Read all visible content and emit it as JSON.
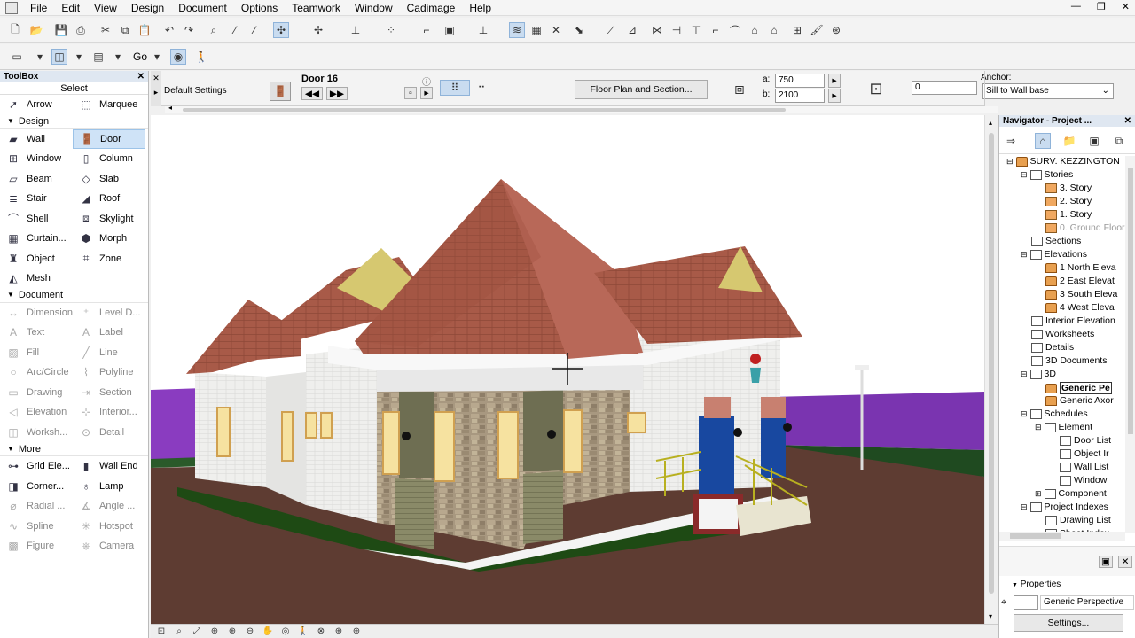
{
  "menu": [
    "File",
    "Edit",
    "View",
    "Design",
    "Document",
    "Options",
    "Teamwork",
    "Window",
    "Cadimage",
    "Help"
  ],
  "window_controls": {
    "minimize": "—",
    "restore": "❐",
    "close": "✕"
  },
  "toolbar2": {
    "go_label": "Go"
  },
  "toolbox": {
    "title": "ToolBox",
    "select_label": "Select",
    "select_tools": [
      {
        "label": "Arrow",
        "icon": "arrow-icon"
      },
      {
        "label": "Marquee",
        "icon": "marquee-icon"
      }
    ],
    "sections": [
      {
        "label": "Design",
        "tools": [
          {
            "label": "Wall",
            "icon": "wall-icon"
          },
          {
            "label": "Door",
            "icon": "door-icon",
            "selected": true
          },
          {
            "label": "Window",
            "icon": "window-icon"
          },
          {
            "label": "Column",
            "icon": "column-icon"
          },
          {
            "label": "Beam",
            "icon": "beam-icon"
          },
          {
            "label": "Slab",
            "icon": "slab-icon"
          },
          {
            "label": "Stair",
            "icon": "stair-icon"
          },
          {
            "label": "Roof",
            "icon": "roof-icon"
          },
          {
            "label": "Shell",
            "icon": "shell-icon"
          },
          {
            "label": "Skylight",
            "icon": "skylight-icon"
          },
          {
            "label": "Curtain...",
            "icon": "curtain-wall-icon"
          },
          {
            "label": "Morph",
            "icon": "morph-icon"
          },
          {
            "label": "Object",
            "icon": "object-icon"
          },
          {
            "label": "Zone",
            "icon": "zone-icon"
          },
          {
            "label": "Mesh",
            "icon": "mesh-icon"
          }
        ]
      },
      {
        "label": "Document",
        "tools": [
          {
            "label": "Dimension",
            "icon": "dimension-icon"
          },
          {
            "label": "Level D...",
            "icon": "level-dimension-icon"
          },
          {
            "label": "Text",
            "icon": "text-icon"
          },
          {
            "label": "Label",
            "icon": "label-icon"
          },
          {
            "label": "Fill",
            "icon": "fill-icon"
          },
          {
            "label": "Line",
            "icon": "line-icon"
          },
          {
            "label": "Arc/Circle",
            "icon": "arc-icon"
          },
          {
            "label": "Polyline",
            "icon": "polyline-icon"
          },
          {
            "label": "Drawing",
            "icon": "drawing-icon"
          },
          {
            "label": "Section",
            "icon": "section-icon"
          },
          {
            "label": "Elevation",
            "icon": "elevation-icon"
          },
          {
            "label": "Interior...",
            "icon": "interior-elevation-icon"
          },
          {
            "label": "Worksh...",
            "icon": "worksheet-icon"
          },
          {
            "label": "Detail",
            "icon": "detail-icon"
          }
        ]
      },
      {
        "label": "More",
        "tools": [
          {
            "label": "Grid Ele...",
            "icon": "grid-element-icon"
          },
          {
            "label": "Wall End",
            "icon": "wall-end-icon"
          },
          {
            "label": "Corner...",
            "icon": "corner-window-icon"
          },
          {
            "label": "Lamp",
            "icon": "lamp-icon"
          },
          {
            "label": "Radial ...",
            "icon": "radial-dimension-icon"
          },
          {
            "label": "Angle ...",
            "icon": "angle-dimension-icon"
          },
          {
            "label": "Spline",
            "icon": "spline-icon"
          },
          {
            "label": "Hotspot",
            "icon": "hotspot-icon"
          },
          {
            "label": "Figure",
            "icon": "figure-icon"
          },
          {
            "label": "Camera",
            "icon": "camera-icon"
          }
        ]
      }
    ]
  },
  "infobox": {
    "settings_label": "Default Settings",
    "element_name": "Door 16",
    "floor_plan_button": "Floor Plan and Section...",
    "a_label": "a:",
    "a_value": "750",
    "b_label": "b:",
    "b_value": "2100",
    "offset_value": "0",
    "anchor_label": "Anchor:",
    "anchor_value": "Sill to Wall base"
  },
  "navigator": {
    "title": "Navigator - Project ...",
    "tree": [
      {
        "label": "SURV. KEZZINGTON",
        "level": 0,
        "type": "house",
        "expander": "⊟"
      },
      {
        "label": "Stories",
        "level": 1,
        "type": "doc",
        "expander": "⊟"
      },
      {
        "label": "3. Story",
        "level": 2,
        "type": "folder"
      },
      {
        "label": "2. Story",
        "level": 2,
        "type": "folder"
      },
      {
        "label": "1. Story",
        "level": 2,
        "type": "folder"
      },
      {
        "label": "0. Ground Floor",
        "level": 2,
        "type": "folder",
        "dim": true
      },
      {
        "label": "Sections",
        "level": 1,
        "type": "doc"
      },
      {
        "label": "Elevations",
        "level": 1,
        "type": "doc",
        "expander": "⊟"
      },
      {
        "label": "1 North Eleva",
        "level": 2,
        "type": "house"
      },
      {
        "label": "2 East Elevat",
        "level": 2,
        "type": "house"
      },
      {
        "label": "3 South Eleva",
        "level": 2,
        "type": "house"
      },
      {
        "label": "4 West Eleva",
        "level": 2,
        "type": "house"
      },
      {
        "label": "Interior Elevation",
        "level": 1,
        "type": "doc"
      },
      {
        "label": "Worksheets",
        "level": 1,
        "type": "doc"
      },
      {
        "label": "Details",
        "level": 1,
        "type": "doc"
      },
      {
        "label": "3D Documents",
        "level": 1,
        "type": "doc"
      },
      {
        "label": "3D",
        "level": 1,
        "type": "doc",
        "expander": "⊟"
      },
      {
        "label": "Generic Pe",
        "level": 2,
        "type": "house",
        "selected": true
      },
      {
        "label": "Generic Axor",
        "level": 2,
        "type": "house"
      },
      {
        "label": "Schedules",
        "level": 1,
        "type": "doc",
        "expander": "⊟"
      },
      {
        "label": "Element",
        "level": 2,
        "type": "doc",
        "expander": "⊟"
      },
      {
        "label": "Door List",
        "level": 3,
        "type": "doc"
      },
      {
        "label": "Object Ir",
        "level": 3,
        "type": "doc"
      },
      {
        "label": "Wall List",
        "level": 3,
        "type": "doc"
      },
      {
        "label": "Window",
        "level": 3,
        "type": "doc"
      },
      {
        "label": "Component",
        "level": 2,
        "type": "doc",
        "expander": "⊞"
      },
      {
        "label": "Project Indexes",
        "level": 1,
        "type": "doc",
        "expander": "⊟"
      },
      {
        "label": "Drawing List",
        "level": 2,
        "type": "doc"
      },
      {
        "label": "Sheet Index",
        "level": 2,
        "type": "doc"
      }
    ],
    "properties_label": "Properties",
    "properties_value": "Generic Perspective",
    "settings_button": "Settings..."
  },
  "colors": {
    "roof": "#a85a48",
    "stone": "#a89880",
    "wall": "#f4f4f2",
    "purple": "#8038b8",
    "ground": "#5a3a30",
    "blue": "#1848a0"
  }
}
